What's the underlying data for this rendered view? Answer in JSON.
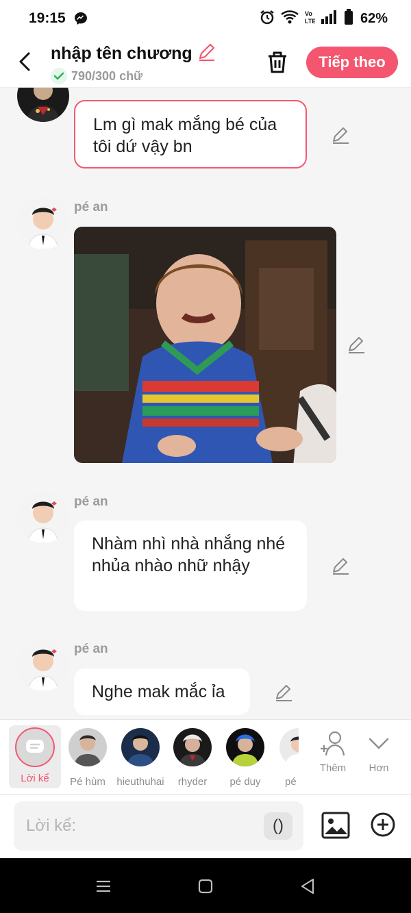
{
  "status_bar": {
    "time": "19:15",
    "battery": "62%",
    "icons": [
      "messenger-icon",
      "alarm-icon",
      "wifi-icon",
      "volte-icon",
      "signal-icon",
      "battery-icon"
    ]
  },
  "header": {
    "title": "nhập tên chương",
    "word_count": "790/300 chữ",
    "next_label": "Tiếp theo",
    "accent": "#f5566f"
  },
  "messages": [
    {
      "type": "text",
      "author": "",
      "text": "Lm gì mak mắng bé của tôi dứ vậy bn",
      "selected": true
    },
    {
      "type": "image",
      "author": "pé an",
      "image": "meme photo of crying child in striped sweater"
    },
    {
      "type": "text",
      "author": "pé an",
      "text": "Nhàm nhì nhà nhắng nhé nhủa nhào nhữ nhậy",
      "selected": false
    },
    {
      "type": "text",
      "author": "pé an",
      "text": "Nghe mak mắc ỉa",
      "selected": false
    }
  ],
  "characters": [
    {
      "label": "Lời kể",
      "active": true
    },
    {
      "label": "Pé hùm",
      "active": false
    },
    {
      "label": "hieuthuhai",
      "active": false
    },
    {
      "label": "rhyder",
      "active": false
    },
    {
      "label": "pé duy",
      "active": false
    },
    {
      "label": "pé",
      "active": false
    }
  ],
  "tools": {
    "add_label": "Thêm",
    "more_label": "Hơn"
  },
  "input": {
    "placeholder": "Lời kể:",
    "paren_label": "()"
  }
}
